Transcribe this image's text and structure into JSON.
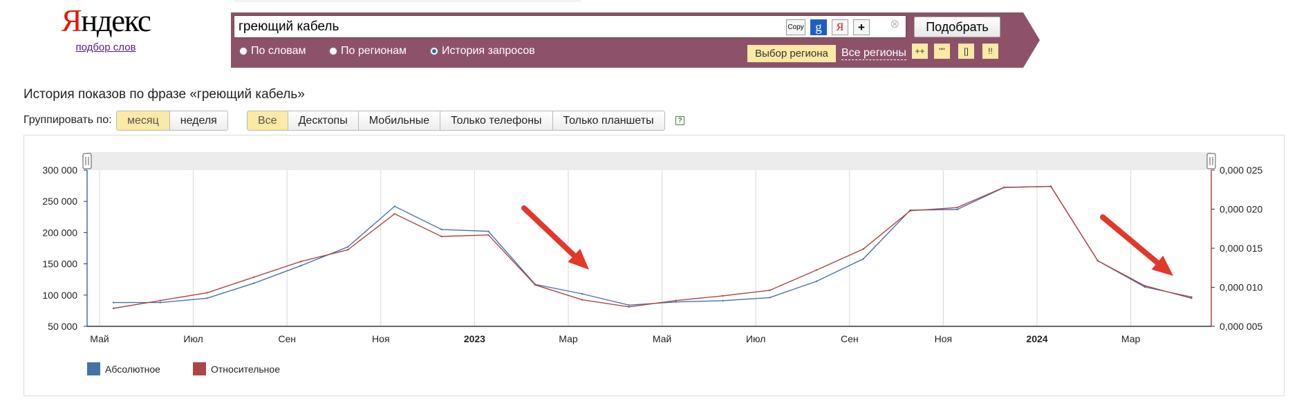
{
  "logo": {
    "text_red": "Я",
    "text_rest": "ндекс",
    "subtitle": "подбор слов"
  },
  "search": {
    "query": "греющий кабель",
    "copy_label": "Copy",
    "google_label": "g",
    "yandex_label": "Я",
    "plus_label": "+",
    "clear_label": "⊗",
    "submit_label": "Подобрать",
    "modes": [
      {
        "label": "По словам",
        "selected": false
      },
      {
        "label": "По регионам",
        "selected": false
      },
      {
        "label": "История запросов",
        "selected": true
      }
    ],
    "region_button": "Выбор региона",
    "all_regions": "Все регионы",
    "operators": [
      "++",
      "\"\"",
      "[]",
      "!!"
    ]
  },
  "page": {
    "title": "История показов по фразе «греющий кабель»",
    "group_label": "Группировать по:",
    "group_options": [
      "месяц",
      "неделя"
    ],
    "group_selected": "месяц",
    "device_options": [
      "Все",
      "Десктопы",
      "Мобильные",
      "Только телефоны",
      "Только планшеты"
    ],
    "device_selected": "Все",
    "help_icon": "?"
  },
  "chart_data": {
    "type": "line",
    "x": [
      "2022-05",
      "2022-06",
      "2022-07",
      "2022-08",
      "2022-09",
      "2022-10",
      "2022-11",
      "2022-12",
      "2023-01",
      "2023-02",
      "2023-03",
      "2023-04",
      "2023-05",
      "2023-06",
      "2023-07",
      "2023-08",
      "2023-09",
      "2023-10",
      "2023-11",
      "2023-12",
      "2024-01",
      "2024-02",
      "2024-03",
      "2024-04"
    ],
    "x_tick_labels": [
      {
        "x": "2022-05",
        "label": "Май",
        "bold": false
      },
      {
        "x": "2022-07",
        "label": "Июл",
        "bold": false
      },
      {
        "x": "2022-09",
        "label": "Сен",
        "bold": false
      },
      {
        "x": "2022-11",
        "label": "Ноя",
        "bold": false
      },
      {
        "x": "2023-01",
        "label": "2023",
        "bold": true
      },
      {
        "x": "2023-03",
        "label": "Мар",
        "bold": false
      },
      {
        "x": "2023-05",
        "label": "Май",
        "bold": false
      },
      {
        "x": "2023-07",
        "label": "Июл",
        "bold": false
      },
      {
        "x": "2023-09",
        "label": "Сен",
        "bold": false
      },
      {
        "x": "2023-11",
        "label": "Ноя",
        "bold": false
      },
      {
        "x": "2024-01",
        "label": "2024",
        "bold": true
      },
      {
        "x": "2024-03",
        "label": "Мар",
        "bold": false
      }
    ],
    "y_left": {
      "ticks": [
        "300 000",
        "250 000",
        "200 000",
        "150 000",
        "100 000",
        "50 000"
      ],
      "min": 50000,
      "max": 300000
    },
    "y_right": {
      "ticks": [
        "0,000 025",
        "0,000 020",
        "0,000 015",
        "0,000 010",
        "0,000 005"
      ],
      "min": 5e-06,
      "max": 2.5e-05
    },
    "series": [
      {
        "name": "Абсолютное",
        "axis": "left",
        "color": "#4572a7",
        "values": [
          88000,
          88000,
          95000,
          119000,
          147000,
          177000,
          242000,
          205000,
          202000,
          117000,
          102000,
          84000,
          89000,
          91000,
          96000,
          122000,
          158000,
          236000,
          237000,
          272000,
          274000,
          155000,
          113000,
          97000
        ]
      },
      {
        "name": "Относительное",
        "axis": "right",
        "color": "#aa4643",
        "values": [
          7.3e-06,
          8.3e-06,
          9.3e-06,
          1.13e-05,
          1.33e-05,
          1.48e-05,
          1.94e-05,
          1.65e-05,
          1.67e-05,
          1.03e-05,
          8.4e-06,
          7.5e-06,
          8.3e-06,
          8.9e-06,
          9.6e-06,
          1.22e-05,
          1.49e-05,
          1.98e-05,
          2.02e-05,
          2.28e-05,
          2.29e-05,
          1.34e-05,
          1.02e-05,
          8.6e-06
        ]
      }
    ],
    "grid": true,
    "legend_position": "bottom-left",
    "annotations": [
      {
        "type": "arrow",
        "color": "#e2382a"
      },
      {
        "type": "arrow",
        "color": "#e2382a"
      }
    ]
  }
}
